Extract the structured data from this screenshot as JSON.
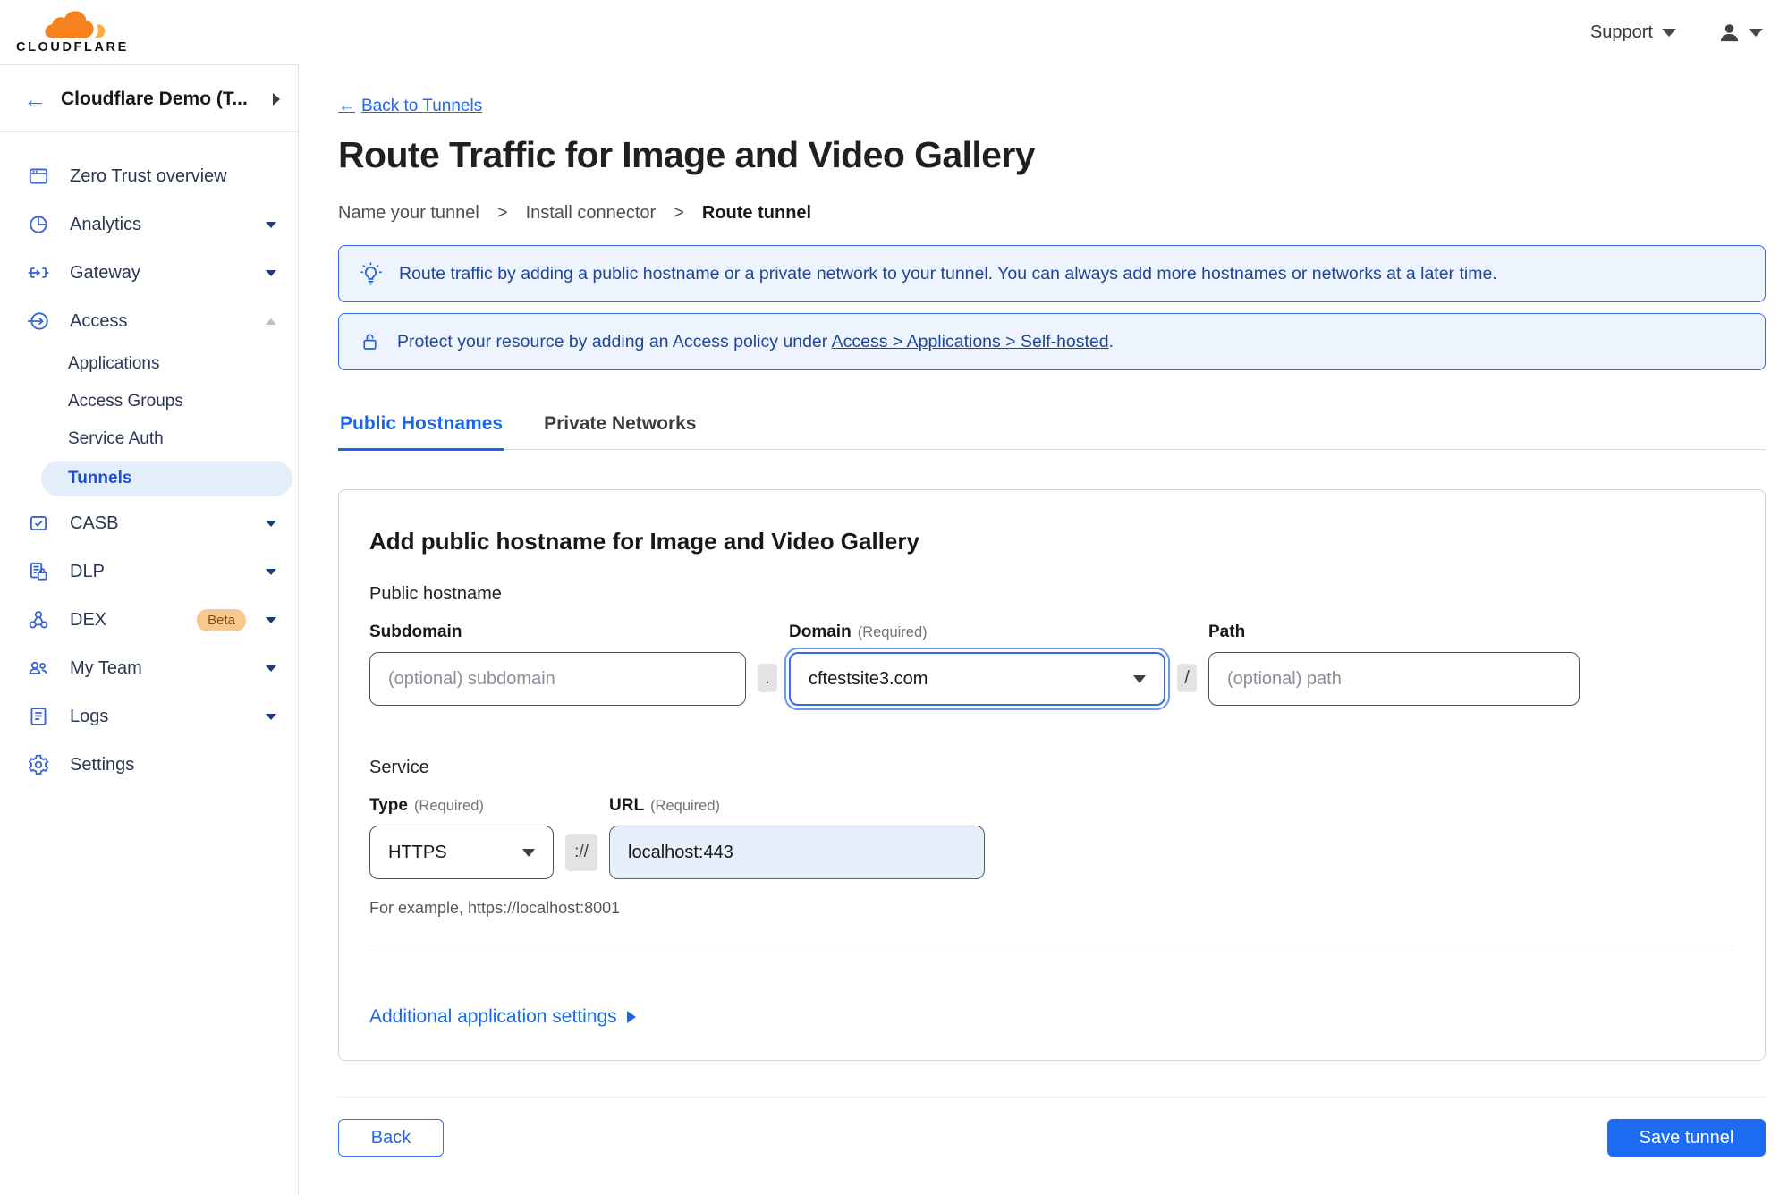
{
  "topbar": {
    "logo_text": "CLOUDFLARE",
    "support_label": "Support"
  },
  "sidebar": {
    "back_arrow": "←",
    "account_name": "Cloudflare Demo (T...",
    "items": [
      {
        "label": "Zero Trust overview"
      },
      {
        "label": "Analytics"
      },
      {
        "label": "Gateway"
      },
      {
        "label": "Access",
        "children": [
          {
            "label": "Applications"
          },
          {
            "label": "Access Groups"
          },
          {
            "label": "Service Auth"
          },
          {
            "label": "Tunnels"
          }
        ]
      },
      {
        "label": "CASB"
      },
      {
        "label": "DLP"
      },
      {
        "label": "DEX",
        "badge": "Beta"
      },
      {
        "label": "My Team"
      },
      {
        "label": "Logs"
      },
      {
        "label": "Settings"
      }
    ]
  },
  "main": {
    "back_arrow": "←",
    "back_link": "Back to Tunnels",
    "title": "Route Traffic for Image and Video Gallery",
    "steps": {
      "step1": "Name your tunnel",
      "step2": "Install connector",
      "step3": "Route tunnel",
      "separator": ">"
    },
    "banner_info": "Route traffic by adding a public hostname or a private network to your tunnel. You can always add more hostnames or networks at a later time.",
    "banner_access_prefix": "Protect your resource by adding an Access policy under",
    "banner_access_link": "Access > Applications > Self-hosted",
    "banner_access_suffix": ".",
    "tabs": {
      "public": "Public Hostnames",
      "private": "Private Networks"
    },
    "card": {
      "heading": "Add public hostname for Image and Video Gallery",
      "public_hostname_label": "Public hostname",
      "subdomain_label": "Subdomain",
      "subdomain_placeholder": "(optional) subdomain",
      "dot_separator": ".",
      "domain_label": "Domain",
      "required_note": "(Required)",
      "domain_value": "cftestsite3.com",
      "slash_separator": "/",
      "path_label": "Path",
      "path_placeholder": "(optional) path",
      "service_label": "Service",
      "type_label": "Type",
      "type_value": "HTTPS",
      "protocol_separator": "://",
      "url_label": "URL",
      "url_value": "localhost:443",
      "url_hint": "For example, https://localhost:8001",
      "additional_settings_label": "Additional application settings"
    },
    "footer": {
      "back_label": "Back",
      "save_label": "Save tunnel"
    }
  },
  "colors": {
    "accent_blue": "#1d6bf2",
    "banner_bg": "#edf4fd",
    "banner_border": "#3069e8",
    "active_pill_bg": "#e4eefb",
    "beta_badge_bg": "#f7c98f",
    "url_filled_bg": "#e7effd"
  }
}
